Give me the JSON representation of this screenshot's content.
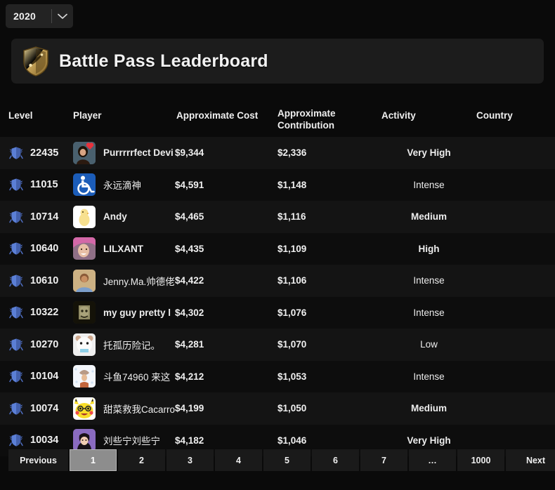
{
  "year_select": {
    "value": "2020",
    "icon": "chevron-down-icon"
  },
  "banner": {
    "icon": "gold-shield-icon",
    "title": "Battle Pass Leaderboard"
  },
  "table": {
    "headers": {
      "level": "Level",
      "player": "Player",
      "cost": "Approximate Cost",
      "contribution_line1": "Approximate",
      "contribution_line2": "Contribution",
      "activity": "Activity",
      "country": "Country"
    },
    "rows": [
      {
        "level": "22435",
        "player": "Purrrrrfect Devi",
        "cjk": false,
        "cost": "$9,344",
        "contribution": "$2,336",
        "activity": "Very High",
        "activity_bold": true,
        "country": "",
        "avatar": "photo-woman-avatar",
        "avatar_bg": "#3a4a5a"
      },
      {
        "level": "11015",
        "player": "永远滴神",
        "cjk": true,
        "cost": "$4,591",
        "contribution": "$1,148",
        "activity": "Intense",
        "activity_bold": false,
        "country": "",
        "avatar": "wheelchair-symbol-avatar",
        "avatar_bg": "#1b5cb8"
      },
      {
        "level": "10714",
        "player": "Andy",
        "cjk": false,
        "cost": "$4,465",
        "contribution": "$1,116",
        "activity": "Medium",
        "activity_bold": true,
        "country": "",
        "avatar": "yellow-chick-avatar",
        "avatar_bg": "#ffffff"
      },
      {
        "level": "10640",
        "player": "LILXANT",
        "cjk": false,
        "cost": "$4,435",
        "contribution": "$1,109",
        "activity": "High",
        "activity_bold": true,
        "country": "",
        "avatar": "pink-hair-person-avatar",
        "avatar_bg": "#c98ab0"
      },
      {
        "level": "10610",
        "player": "Jenny.Ma.帅德佬",
        "cjk": true,
        "cost": "$4,422",
        "contribution": "$1,106",
        "activity": "Intense",
        "activity_bold": false,
        "country": "",
        "avatar": "person-outdoors-avatar",
        "avatar_bg": "#c6a87a"
      },
      {
        "level": "10322",
        "player": "my guy pretty l",
        "cjk": false,
        "cost": "$4,302",
        "contribution": "$1,076",
        "activity": "Intense",
        "activity_bold": false,
        "country": "",
        "avatar": "stone-face-avatar",
        "avatar_bg": "#6e6a4e"
      },
      {
        "level": "10270",
        "player": "托孤历险记。",
        "cjk": true,
        "cost": "$4,281",
        "contribution": "$1,070",
        "activity": "Low",
        "activity_bold": false,
        "country": "",
        "avatar": "white-bear-avatar",
        "avatar_bg": "#efefef"
      },
      {
        "level": "10104",
        "player": "斗鱼74960 来这",
        "cjk": true,
        "cost": "$4,212",
        "contribution": "$1,053",
        "activity": "Intense",
        "activity_bold": false,
        "country": "",
        "avatar": "snowy-character-avatar",
        "avatar_bg": "#f4f6fa"
      },
      {
        "level": "10074",
        "player": "甜菜救我Cacarrot",
        "cjk": true,
        "cost": "$4,199",
        "contribution": "$1,050",
        "activity": "Medium",
        "activity_bold": true,
        "country": "",
        "avatar": "pikachu-avatar",
        "avatar_bg": "#f8dd2a"
      },
      {
        "level": "10034",
        "player": "刘些宁刘些宁",
        "cjk": true,
        "cost": "$4,182",
        "contribution": "$1,046",
        "activity": "Very High",
        "activity_bold": true,
        "country": "",
        "avatar": "purple-girl-avatar",
        "avatar_bg": "#8a6bc0"
      }
    ]
  },
  "pagination": {
    "previous": "Previous",
    "pages": [
      "1",
      "2",
      "3",
      "4",
      "5",
      "6",
      "7",
      "…",
      "1000"
    ],
    "active_page": "1",
    "next": "Next"
  }
}
